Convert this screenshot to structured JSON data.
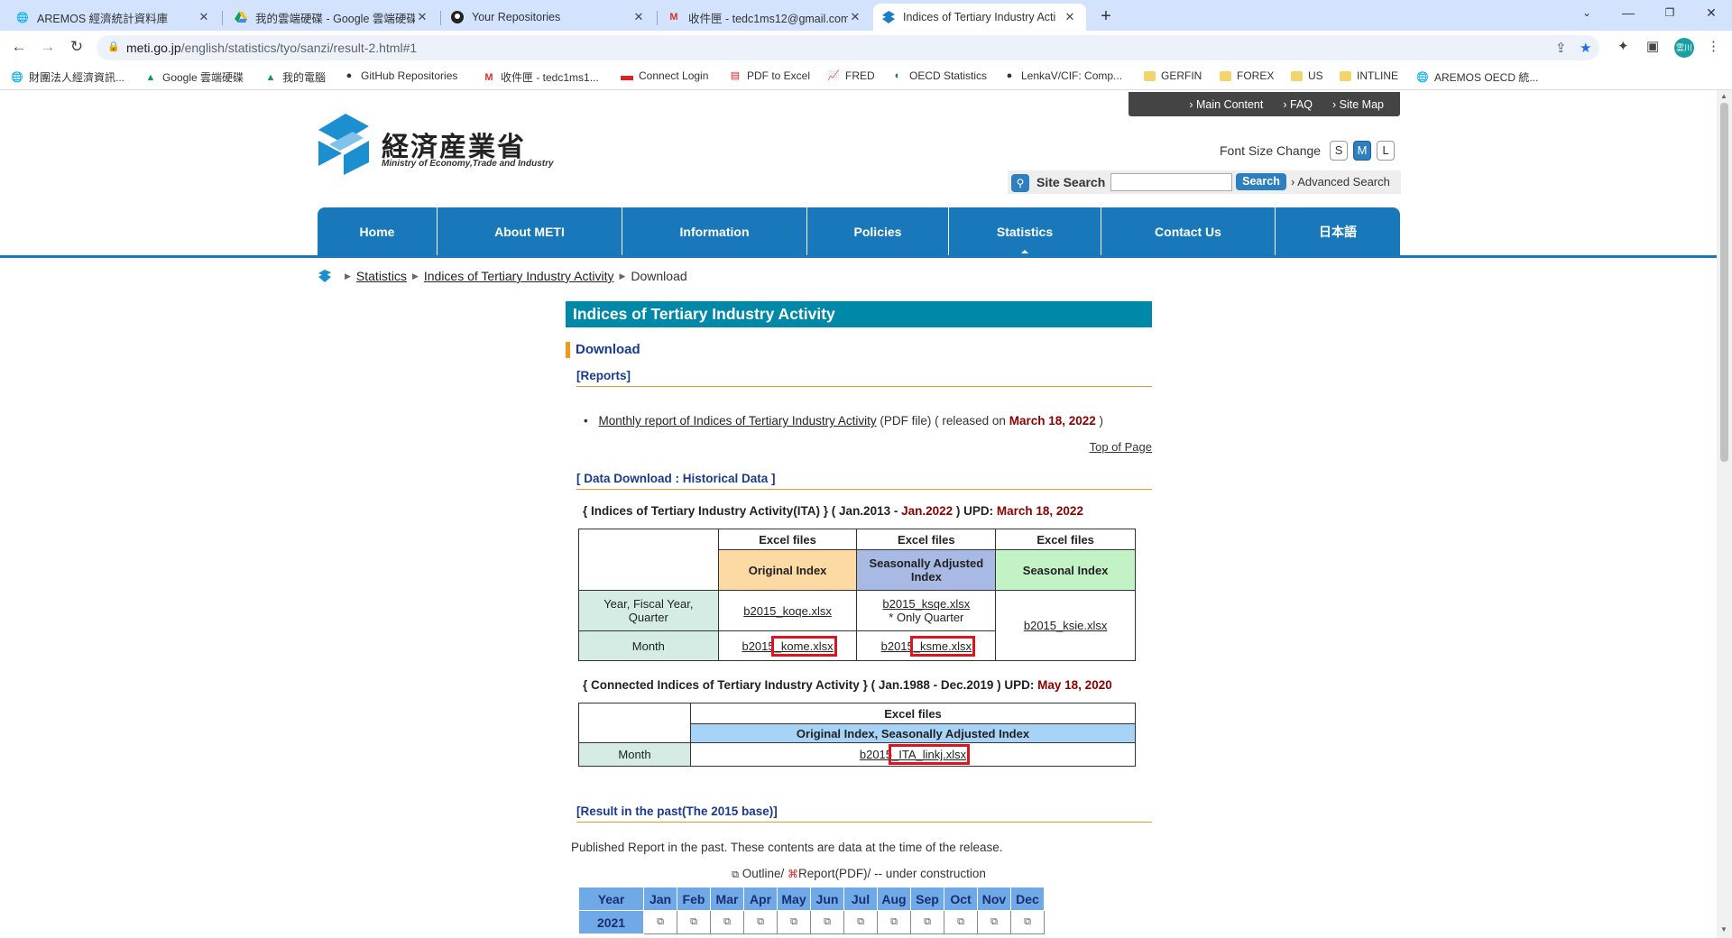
{
  "browser": {
    "tabs": [
      {
        "title": "AREMOS 經濟統計資料庫",
        "icon": "globe-icon"
      },
      {
        "title": "我的雲端硬碟 - Google 雲端硬碟",
        "icon": "google-drive-icon"
      },
      {
        "title": "Your Repositories",
        "icon": "github-icon"
      },
      {
        "title": "收件匣 - tedc1ms12@gmail.com",
        "icon": "gmail-icon"
      },
      {
        "title": "Indices of Tertiary Industry Acti",
        "icon": "meti-icon",
        "active": true
      }
    ],
    "url_host": "meti.go.jp",
    "url_path": "/english/statistics/tyo/sanzi/result-2.html#1",
    "profile_initials": "霊川",
    "bookmarks": [
      {
        "label": "財團法人經濟資訊...",
        "icon": "globe-icon"
      },
      {
        "label": "Google 雲端硬碟",
        "icon": "google-drive-icon"
      },
      {
        "label": "我的電腦",
        "icon": "google-drive-icon"
      },
      {
        "label": "GitHub Repositories",
        "icon": "github-icon"
      },
      {
        "label": "收件匣 - tedc1ms1...",
        "icon": "gmail-icon"
      },
      {
        "label": "Connect Login",
        "icon": "flag-icon"
      },
      {
        "label": "PDF to Excel",
        "icon": "pdf-icon"
      },
      {
        "label": "FRED",
        "icon": "chart-icon"
      },
      {
        "label": "OECD Statistics",
        "icon": "oecd-icon"
      },
      {
        "label": "LenkaV/CIF: Comp...",
        "icon": "github-icon"
      },
      {
        "label": "GERFIN",
        "icon": "folder-icon"
      },
      {
        "label": "FOREX",
        "icon": "folder-icon"
      },
      {
        "label": "US",
        "icon": "folder-icon"
      },
      {
        "label": "INTLINE",
        "icon": "folder-icon"
      },
      {
        "label": "AREMOS OECD 統...",
        "icon": "globe-icon"
      }
    ]
  },
  "site": {
    "topbar": [
      "Main Content",
      "FAQ",
      "Site Map"
    ],
    "logo_jp": "経済産業省",
    "logo_en": "Ministry of Economy,Trade and Industry",
    "font_size_label": "Font Size Change",
    "font_sizes": [
      "S",
      "M",
      "L"
    ],
    "search_label": "Site Search",
    "search_value": "",
    "search_button": "Search",
    "advanced_search": "Advanced Search",
    "nav": [
      "Home",
      "About METI",
      "Information",
      "Policies",
      "Statistics",
      "Contact Us",
      "日本語"
    ],
    "breadcrumb": [
      "Statistics",
      "Indices of Tertiary Industry Activity",
      "Download"
    ]
  },
  "content": {
    "title": "Indices of Tertiary Industry Activity",
    "download_heading": "Download",
    "reports_heading": "[Reports]",
    "report_link": "Monthly report of Indices of Tertiary Industry Activity",
    "report_mid": " (PDF file) ( released on ",
    "report_date": "March 18, 2022",
    "report_end": " )",
    "top_of_page": "Top of Page",
    "hist_heading": "[ Data Download : Historical Data ]",
    "ita": {
      "note_a": "{ Indices of Tertiary Industry Activity(ITA) } ( Jan.2013 - ",
      "note_b": "Jan.2022",
      "note_c": " ) UPD: ",
      "note_d": "March 18, 2022",
      "excel_files": "Excel files",
      "col_original": "Original Index",
      "col_sa": "Seasonally Adjusted Index",
      "col_seasonal": "Seasonal Index",
      "row_year": "Year, Fiscal Year, Quarter",
      "row_month": "Month",
      "koqe": "b2015_koqe.xlsx",
      "ksqe": "b2015_ksqe.xlsx",
      "only_quarter": "* Only Quarter",
      "ksie": "b2015_ksie.xlsx",
      "kome_a": "b2015",
      "kome_b": "_kome.xlsx",
      "ksme_a": "b2015",
      "ksme_b": "_ksme.xlsx"
    },
    "cita": {
      "note_a": "{ Connected Indices of Tertiary Industry Activity } ( Jan.1988 - Dec.2019 ) UPD: ",
      "note_b": "May 18, 2020",
      "excel_files": "Excel files",
      "col_header": "Original Index, Seasonally Adjusted Index",
      "row_month": "Month",
      "link_a": "b2015",
      "link_b": "_ITA_linkj.xlsx"
    },
    "past_heading": "[Result in the past(The 2015 base)]",
    "past_text": "Published Report in the past. These contents are data at the time of the release.",
    "legend_outline": "Outline/",
    "legend_report": "Report(PDF)/",
    "legend_rest": " -- under construction",
    "year_header": "Year",
    "months": [
      "Jan",
      "Feb",
      "Mar",
      "Apr",
      "May",
      "Jun",
      "Jul",
      "Aug",
      "Sep",
      "Oct",
      "Nov",
      "Dec"
    ],
    "first_year": "2021"
  }
}
